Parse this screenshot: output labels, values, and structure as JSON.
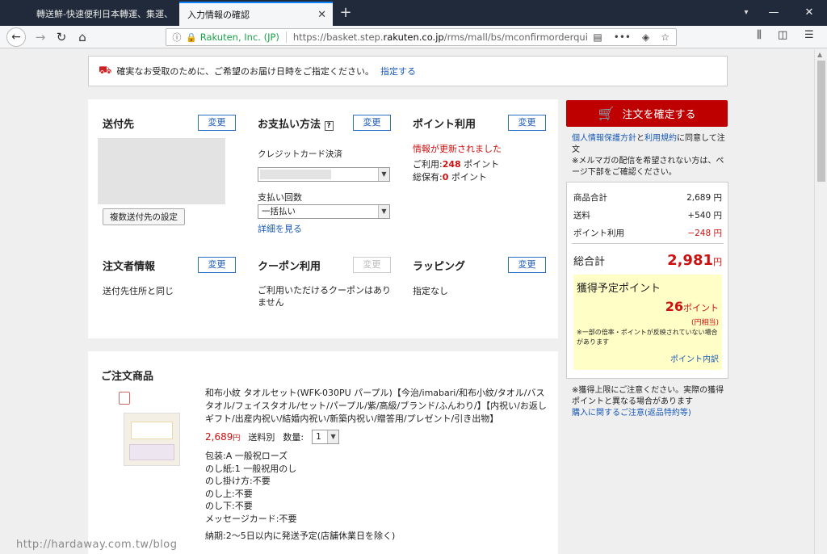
{
  "browser": {
    "tabs": [
      {
        "label": "轉送鮮-快速便利日本轉運、集運、"
      },
      {
        "label": "入力情報の確認"
      }
    ],
    "site_identity": "Rakuten, Inc. (JP)",
    "url_prefix": "https://basket.step.",
    "url_domain": "rakuten.co.jp",
    "url_suffix": "/rms/mall/bs/mconfirmorderqui",
    "more_label": "•••"
  },
  "notice": {
    "text": "確実なお受取のために、ご希望のお届け日時をご指定ください。",
    "link": "指定する"
  },
  "sections": {
    "shipping": {
      "title": "送付先",
      "change": "変更",
      "multi_button": "複数送付先の設定"
    },
    "payment": {
      "title": "お支払い方法",
      "help": "?",
      "change": "変更",
      "method_label": "クレジットカード決済",
      "installment_label": "支払い回数",
      "installment_value": "一括払い",
      "details_link": "詳細を見る"
    },
    "points": {
      "title": "ポイント利用",
      "change": "変更",
      "updated": "情報が更新されました",
      "use_prefix": "ご利用:",
      "use_value": "248",
      "use_suffix": " ポイント",
      "total_prefix": "総保有:",
      "total_value": "0",
      "total_suffix": " ポイント"
    },
    "orderer": {
      "title": "注文者情報",
      "change": "変更",
      "value": "送付先住所と同じ"
    },
    "coupon": {
      "title": "クーポン利用",
      "change": "変更",
      "value": "ご利用いただけるクーポンはありません"
    },
    "wrapping": {
      "title": "ラッピング",
      "change": "変更",
      "value": "指定なし"
    }
  },
  "items": {
    "title": "ご注文商品",
    "product": {
      "name": "和布小紋 タオルセット(WFK-030PU パープル)【今治/imabari/和布小紋/タオル/バスタオル/フェイスタオル/セット/パープル/紫/高級/ブランド/ふんわり/】【内祝い/お返しギフト/出産内祝い/結婚内祝い/新築内祝い/贈答用/プレゼント/引き出物】",
      "price": "2,689",
      "price_unit": "円",
      "shipping": "送料別",
      "qty_label": "数量:",
      "qty_value": "1",
      "options": [
        "包装:A 一般祝ローズ",
        "のし紙:1 一般祝用のし",
        "のし掛け方:不要",
        "のし上:不要",
        "のし下:不要",
        "メッセージカード:不要"
      ],
      "delivery": "納期:2〜5日以内に発送予定(店舗休業日を除く)"
    }
  },
  "summary": {
    "order_button": "注文を確定する",
    "agree_link1": "個人情報保護方針",
    "agree_and": "と",
    "agree_link2": "利用規約",
    "agree_text": "に同意して注文",
    "mail_note": "※メルマガの配信を希望されない方は、ページ下部をご確認ください。",
    "subtotal_label": "商品合計",
    "subtotal_value": "2,689 円",
    "shipping_label": "送料",
    "shipping_value": "+540 円",
    "points_label": "ポイント利用",
    "points_value": "−248 円",
    "total_label": "総合計",
    "total_value": "2,981",
    "total_unit": "円",
    "earn_title": "獲得予定ポイント",
    "earn_value": "26",
    "earn_unit": "ポイント",
    "earn_yen": "(円相当)",
    "earn_note": "※一部の倍率・ポイントが反映されていない場合があります",
    "earn_link": "ポイント内訳",
    "limit_note": "※獲得上限にご注意ください。実際の獲得ポイントと異なる場合があります",
    "purchase_link": "購入に関するご注意(返品特約等)"
  },
  "watermark": "http://hardaway.com.tw/blog"
}
